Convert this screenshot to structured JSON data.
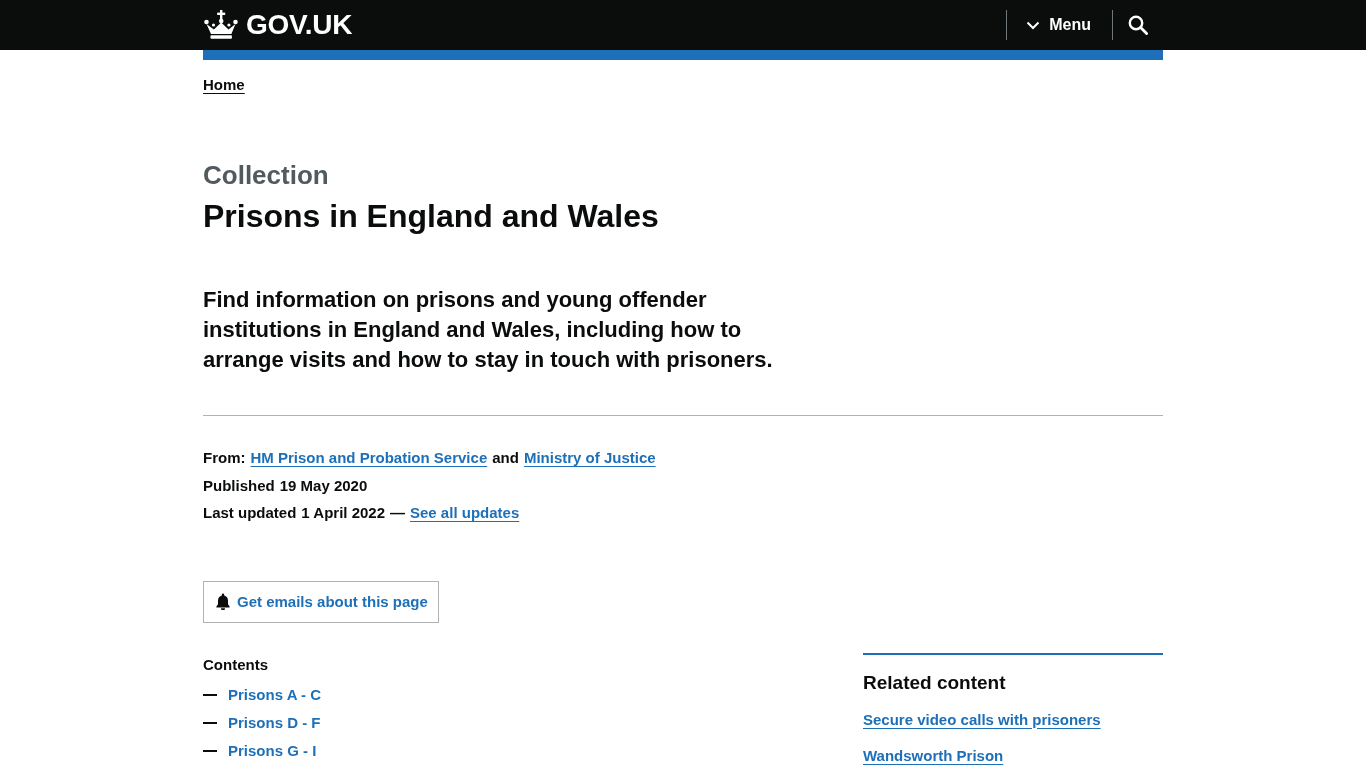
{
  "header": {
    "logo": "GOV.UK",
    "menu_button": "Menu"
  },
  "breadcrumbs": [
    "Home"
  ],
  "caption": "Collection",
  "title": "Prisons in England and Wales",
  "lead": "Find information on prisons and young offender institutions in England and Wales, including how to arrange visits and how to stay in touch with prisoners.",
  "metadata": {
    "from": {
      "label": "From:",
      "organisations": [
        "HM Prison and Probation Service",
        "Ministry of Justice"
      ],
      "conjunction": "and"
    },
    "published": {
      "label": "Published",
      "date": "19 May 2020"
    },
    "last_updated": {
      "label": "Last updated",
      "date": "1 April 2022",
      "separator": "—",
      "link": "See all updates"
    }
  },
  "email_button": "Get emails about this page",
  "contents": {
    "heading": "Contents",
    "items": [
      "Prisons A - C",
      "Prisons D - F",
      "Prisons G - I"
    ]
  },
  "related_content": {
    "heading": "Related content",
    "links": [
      "Secure video calls with prisoners",
      "Wandsworth Prison"
    ]
  }
}
